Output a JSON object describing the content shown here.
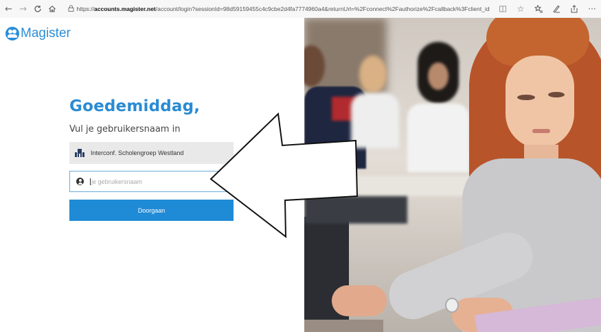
{
  "browser": {
    "url_prefix": "https://",
    "url_host": "accounts.magister.net",
    "url_rest": "/account/login?sessionId=98d59159455c4c9cbe2d4fa7774960a4&returnUrl=%2Fconnect%2Fauthorize%2Fcallback%3Fclient_id%",
    "icons": [
      "back-icon",
      "forward-icon",
      "refresh-icon",
      "home-icon",
      "lock-icon",
      "reading-view-icon",
      "favorite-icon",
      "favorites-list-icon",
      "pen-icon",
      "share-icon",
      "more-icon"
    ]
  },
  "brand": {
    "name": "Magister",
    "color": "#2c8ed6"
  },
  "login": {
    "greeting": "Goedemiddag,",
    "subtitle": "Vul je gebruikersnaam in",
    "school": "Interconf. Scholengroep Westland",
    "username_placeholder": "je gebruikersnaam",
    "continue_label": "Doorgaan",
    "accent": "#1f8ad6"
  }
}
